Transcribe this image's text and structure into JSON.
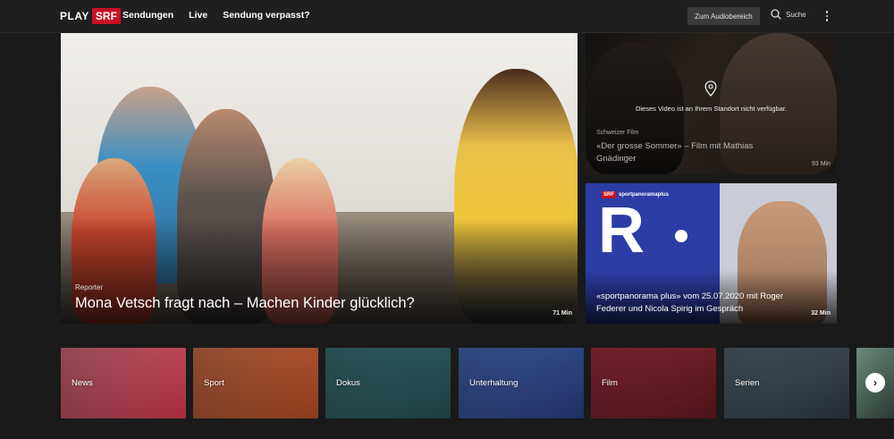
{
  "header": {
    "logo_play": "PLAY",
    "logo_srf": "SRF",
    "nav": [
      "Sendungen",
      "Live",
      "Sendung verpasst?"
    ],
    "audio_button": "Zum Audiobereich",
    "search_label": "Suche"
  },
  "hero": {
    "kicker": "Reporter",
    "title": "Mona Vetsch fragt nach – Machen Kinder glücklich?",
    "duration": "71 Min"
  },
  "side_tiles": [
    {
      "geo_notice": "Dieses Video ist an Ihrem Standort nicht verfügbar.",
      "kicker": "Schweizer Film",
      "title": "«Der grosse Sommer» – Film mit Mathias Gnädinger",
      "duration": "93 Min"
    },
    {
      "brand_srf": "SRF",
      "brand_name": "sportpanoramaplus",
      "art_letter": "R",
      "title": "«sportpanorama plus» vom 25.07.2020 mit Roger Federer und Nicola Spirig im Gespräch",
      "duration": "32 Min"
    }
  ],
  "categories": [
    {
      "label": "News",
      "color": "#c0384a"
    },
    {
      "label": "Sport",
      "color": "#b5532b"
    },
    {
      "label": "Dokus",
      "color": "#2d5a5e"
    },
    {
      "label": "Unterhaltung",
      "color": "#2e4b8a"
    },
    {
      "label": "Film",
      "color": "#7a1f2a"
    },
    {
      "label": "Serien",
      "color": "#3c4a55"
    }
  ],
  "icons": {
    "search": "search-icon",
    "more": "more-vertical-icon",
    "location": "location-pin-icon",
    "next": "chevron-right-icon"
  }
}
